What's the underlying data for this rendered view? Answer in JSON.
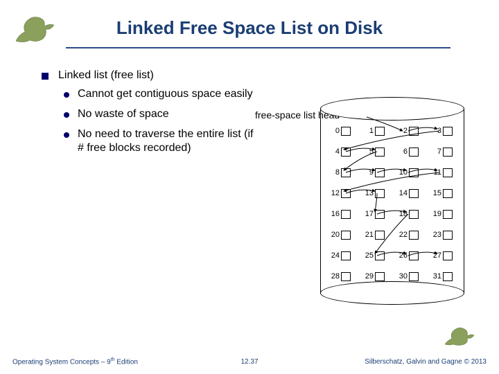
{
  "title": "Linked Free Space List on Disk",
  "heading": "Linked list (free list)",
  "bullets": [
    "Cannot get contiguous space easily",
    "No waste of space",
    "No need to traverse the entire list (if # free blocks recorded)"
  ],
  "free_space_label": "free-space list head",
  "grid": {
    "cells": [
      "0",
      "1",
      "2",
      "3",
      "4",
      "5",
      "6",
      "7",
      "8",
      "9",
      "10",
      "11",
      "12",
      "13",
      "14",
      "15",
      "16",
      "17",
      "18",
      "19",
      "20",
      "21",
      "22",
      "23",
      "24",
      "25",
      "26",
      "27",
      "28",
      "29",
      "30",
      "31"
    ],
    "links": [
      2,
      3,
      4,
      5,
      8,
      9,
      10,
      11,
      12,
      13,
      17,
      18,
      25,
      26,
      27
    ]
  },
  "footer": {
    "left_prefix": "Operating System Concepts – 9",
    "left_sup": "th",
    "left_suffix": " Edition",
    "center": "12.37",
    "right": "Silberschatz, Galvin and Gagne © 2013"
  }
}
